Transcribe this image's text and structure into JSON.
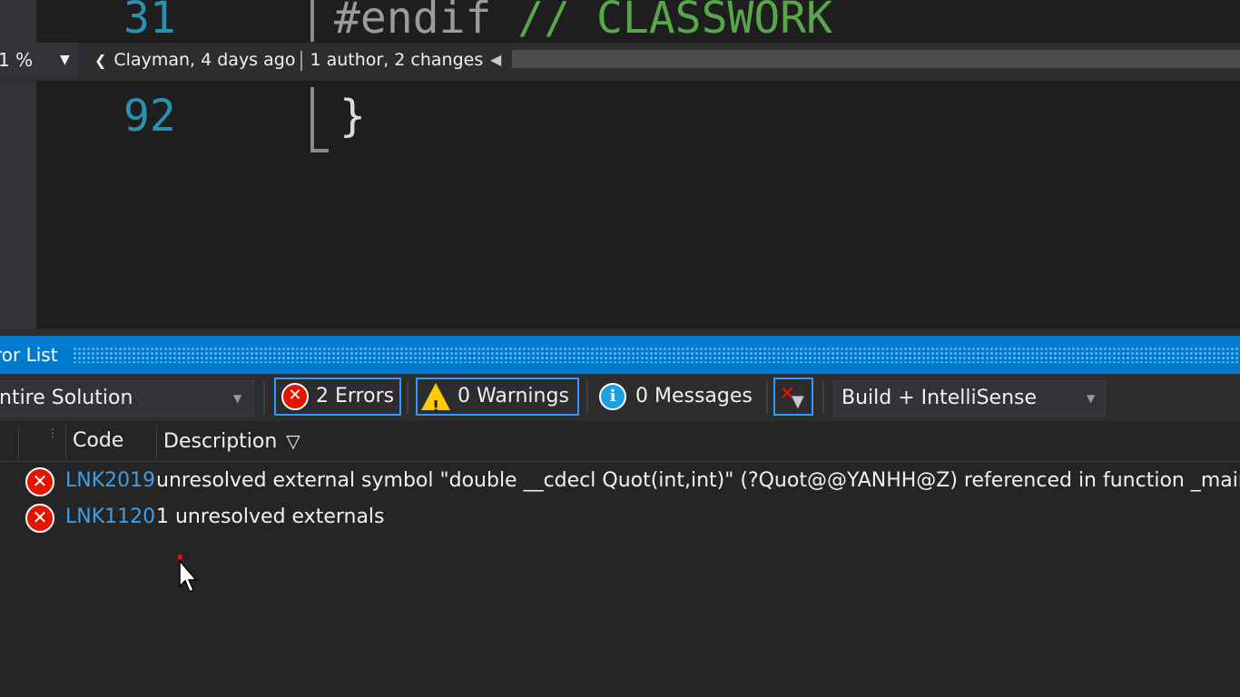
{
  "editor": {
    "line_numbers": [
      "31",
      "92"
    ],
    "line_31_code_preproc": "#endif",
    "line_31_code_comment": " // CLASSWORK",
    "line_92_code": "}",
    "zoom": "1 %",
    "blame": {
      "author_time": "Clayman, 4 days ago",
      "summary": "1 author, 2 changes"
    }
  },
  "error_list": {
    "title": "ror List",
    "scope": "ntire Solution",
    "errors_label": "2 Errors",
    "warnings_label": "0 Warnings",
    "messages_label": "0 Messages",
    "source": "Build + IntelliSense",
    "columns": {
      "code": "Code",
      "description": "Description"
    },
    "rows": [
      {
        "code": "LNK2019",
        "description": "unresolved external symbol \"double __cdecl Quot(int,int)\" (?Quot@@YANHH@Z) referenced in function _main"
      },
      {
        "code": "LNK1120",
        "description": "1 unresolved externals"
      }
    ]
  },
  "icons": {
    "error": "error-circle-icon",
    "warning": "warning-triangle-icon",
    "info": "info-circle-icon",
    "filter": "clear-filter-icon",
    "cursor": "mouse-pointer-icon"
  },
  "colors": {
    "accent": "#007acc",
    "error": "#e51400",
    "link": "#3e9fe8",
    "line_number": "#2b91af",
    "comment": "#57a64a"
  }
}
